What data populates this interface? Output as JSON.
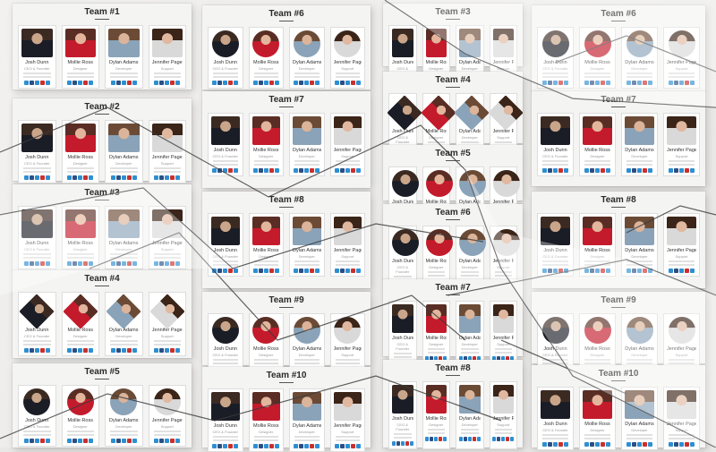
{
  "colors": {
    "social_blue": "#2d8fd1",
    "social_darkblue": "#2a4f85",
    "social_red": "#c9302c",
    "background": "#ebeae8"
  },
  "members": [
    {
      "name": "Josh Dunn",
      "role": "CEO & Founder"
    },
    {
      "name": "Mollie Ross",
      "role": "Designer"
    },
    {
      "name": "Dylan Adams",
      "role": "Developer"
    },
    {
      "name": "Jennifer Page",
      "role": "Support"
    }
  ],
  "panels": [
    {
      "title": "Team #1",
      "style": "square"
    },
    {
      "title": "Team #2",
      "style": "square"
    },
    {
      "title": "Team #3",
      "style": "square"
    },
    {
      "title": "Team #4",
      "style": "diamond"
    },
    {
      "title": "Team #5",
      "style": "circle"
    },
    {
      "title": "Team #6",
      "style": "circle"
    },
    {
      "title": "Team #7",
      "style": "square"
    },
    {
      "title": "Team #8",
      "style": "square"
    },
    {
      "title": "Team #9",
      "style": "circle"
    },
    {
      "title": "Team #10",
      "style": "square"
    },
    {
      "title": "Team #3",
      "style": "square"
    },
    {
      "title": "Team #4",
      "style": "diamond"
    },
    {
      "title": "Team #5",
      "style": "circle"
    },
    {
      "title": "Team #6",
      "style": "circle"
    },
    {
      "title": "Team #7",
      "style": "square"
    },
    {
      "title": "Team #8",
      "style": "square"
    },
    {
      "title": "Team #6",
      "style": "circle"
    },
    {
      "title": "Team #7",
      "style": "square"
    },
    {
      "title": "Team #8",
      "style": "square"
    },
    {
      "title": "Team #9",
      "style": "circle"
    },
    {
      "title": "Team #10",
      "style": "square"
    }
  ]
}
